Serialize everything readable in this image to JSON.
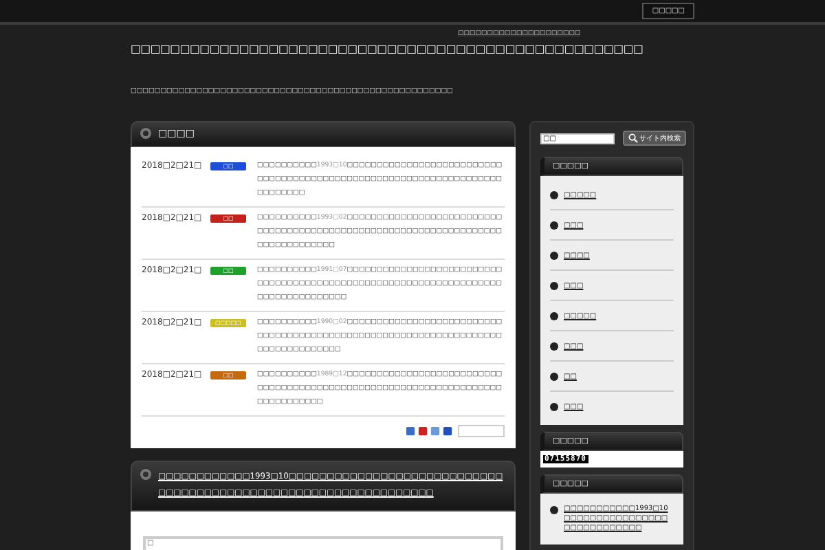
{
  "top_bar": {
    "button": "□□□□□"
  },
  "header": {
    "tagline": "□□□□□□□□□□□□□□□□□□□□□",
    "title": "□□□□□□□□□□□□□□□□□□□□□□□□□□□□□□□□□□□□□□□□□□□□□□□□□□□□",
    "description": "□□□□□□□□□□□□□□□□□□□□□□□□□□□□□□□□□□□□□□□□□□□□□□□□□□□□□□"
  },
  "news": {
    "title": "□□□□",
    "rows": [
      {
        "date": "2018□2□21□",
        "tag": "□□",
        "color": "#1d4fd6",
        "text_before": "□□□□□□□□□□",
        "link": "1993□10",
        "text_after": "□□□□□□□□□□□□□□□□□□□□□□□□□□□□□□□□□□□□□□□□□□□□□□□□□□□□□□□□□□□□□□□□□□□□□□□□□□□"
      },
      {
        "date": "2018□2□21□",
        "tag": "□□",
        "color": "#c4211b",
        "text_before": "□□□□□□□□□□",
        "link": "1993□02",
        "text_after": "□□□□□□□□□□□□□□□□□□□□□□□□□□□□□□□□□□□□□□□□□□□□□□□□□□□□□□□□□□□□□□□□□□□□□□□□□□□□□□□□"
      },
      {
        "date": "2018□2□21□",
        "tag": "□□",
        "color": "#1fa12b",
        "text_before": "□□□□□□□□□□",
        "link": "1991□07",
        "text_after": "□□□□□□□□□□□□□□□□□□□□□□□□□□□□□□□□□□□□□□□□□□□□□□□□□□□□□□□□□□□□□□□□□□□□□□□□□□□□□□□□□□"
      },
      {
        "date": "2018□2□21□",
        "tag": "□□□□□",
        "color": "#cbbf1f",
        "text_before": "□□□□□□□□□□",
        "link": "1990□02",
        "text_after": "□□□□□□□□□□□□□□□□□□□□□□□□□□□□□□□□□□□□□□□□□□□□□□□□□□□□□□□□□□□□□□□□□□□□□□□□□□□□□□□□□"
      },
      {
        "date": "2018□2□21□",
        "tag": "□□",
        "color": "#c4690f",
        "text_before": "□□□□□□□□□□",
        "link": "1989□12",
        "text_after": "□□□□□□□□□□□□□□□□□□□□□□□□□□□□□□□□□□□□□□□□□□□□□□□□□□□□□□□□□□□□□□□□□□□□□□□□□□□□□□"
      }
    ]
  },
  "post": {
    "title": "□□□□□□□□□□□□1993□10□□□□□□□□□□□□□□□□□□□□□□□□□□□□□□□□□□□□□□□□□□□□□□□□□□□□□□□□□□□□□□□□",
    "box_text": "□"
  },
  "sidebar": {
    "search": {
      "value": "□□",
      "button": "サイト内検索"
    },
    "widgets": [
      {
        "kind": "links",
        "title": "□□□□□",
        "items": [
          "□□□□□",
          "□□□",
          "□□□□",
          "□□□",
          "□□□□□",
          "□□□",
          "□□",
          "□□□"
        ]
      },
      {
        "kind": "counter",
        "title": "□□□□□",
        "value": "07155870"
      },
      {
        "kind": "posts",
        "title": "□□□□□",
        "items": [
          "□□□□□□□□□□□1993□10□□□□□□□□□□□□□□□□□□□□□□□□□□□□"
        ]
      }
    ]
  }
}
